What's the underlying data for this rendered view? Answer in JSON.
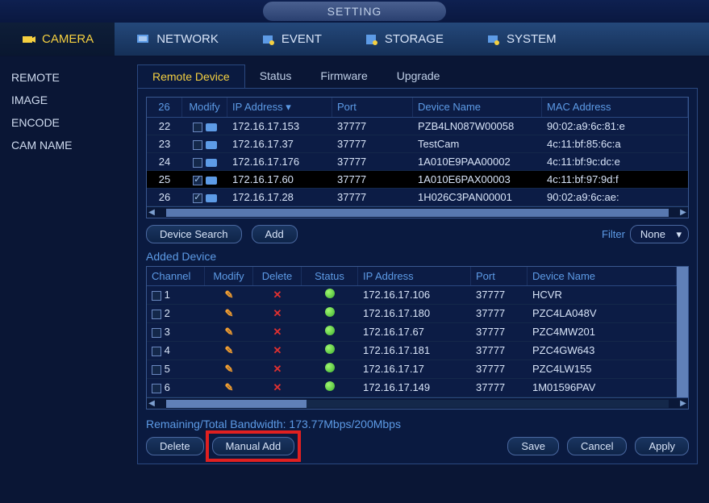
{
  "title": "SETTING",
  "topnav": {
    "camera": "CAMERA",
    "network": "NETWORK",
    "event": "EVENT",
    "storage": "STORAGE",
    "system": "SYSTEM"
  },
  "sidebar": {
    "items": [
      "REMOTE",
      "IMAGE",
      "ENCODE",
      "CAM NAME"
    ]
  },
  "subtabs": {
    "remote_device": "Remote Device",
    "status": "Status",
    "firmware": "Firmware",
    "upgrade": "Upgrade"
  },
  "remote_grid": {
    "headers": {
      "count": "26",
      "modify": "Modify",
      "ip": "IP Address",
      "port": "Port",
      "device": "Device Name",
      "mac": "MAC Address"
    },
    "rows": [
      {
        "idx": "22",
        "checked": false,
        "ip": "172.16.17.153",
        "port": "37777",
        "device": "PZB4LN087W00058",
        "mac": "90:02:a9:6c:81:e"
      },
      {
        "idx": "23",
        "checked": false,
        "ip": "172.16.17.37",
        "port": "37777",
        "device": "TestCam",
        "mac": "4c:11:bf:85:6c:a"
      },
      {
        "idx": "24",
        "checked": false,
        "ip": "172.16.17.176",
        "port": "37777",
        "device": "1A010E9PAA00002",
        "mac": "4c:11:bf:9c:dc:e"
      },
      {
        "idx": "25",
        "checked": true,
        "ip": "172.16.17.60",
        "port": "37777",
        "device": "1A010E6PAX00003",
        "mac": "4c:11:bf:97:9d:f"
      },
      {
        "idx": "26",
        "checked": true,
        "ip": "172.16.17.28",
        "port": "37777",
        "device": "1H026C3PAN00001",
        "mac": "90:02:a9:6c:ae:"
      }
    ]
  },
  "controls": {
    "device_search": "Device Search",
    "add": "Add",
    "filter_label": "Filter",
    "filter_value": "None"
  },
  "added_label": "Added Device",
  "added_grid": {
    "headers": {
      "channel": "Channel",
      "modify": "Modify",
      "delete": "Delete",
      "status": "Status",
      "ip": "IP Address",
      "port": "Port",
      "device": "Device Name"
    },
    "rows": [
      {
        "ch": "1",
        "ip": "172.16.17.106",
        "port": "37777",
        "device": "HCVR"
      },
      {
        "ch": "2",
        "ip": "172.16.17.180",
        "port": "37777",
        "device": "PZC4LA048V"
      },
      {
        "ch": "3",
        "ip": "172.16.17.67",
        "port": "37777",
        "device": "PZC4MW201"
      },
      {
        "ch": "4",
        "ip": "172.16.17.181",
        "port": "37777",
        "device": "PZC4GW643"
      },
      {
        "ch": "5",
        "ip": "172.16.17.17",
        "port": "37777",
        "device": "PZC4LW155"
      },
      {
        "ch": "6",
        "ip": "172.16.17.149",
        "port": "37777",
        "device": "1M01596PAV"
      }
    ]
  },
  "bandwidth": "Remaining/Total Bandwidth: 173.77Mbps/200Mbps",
  "bottom": {
    "delete": "Delete",
    "manual_add": "Manual Add",
    "save": "Save",
    "cancel": "Cancel",
    "apply": "Apply"
  }
}
